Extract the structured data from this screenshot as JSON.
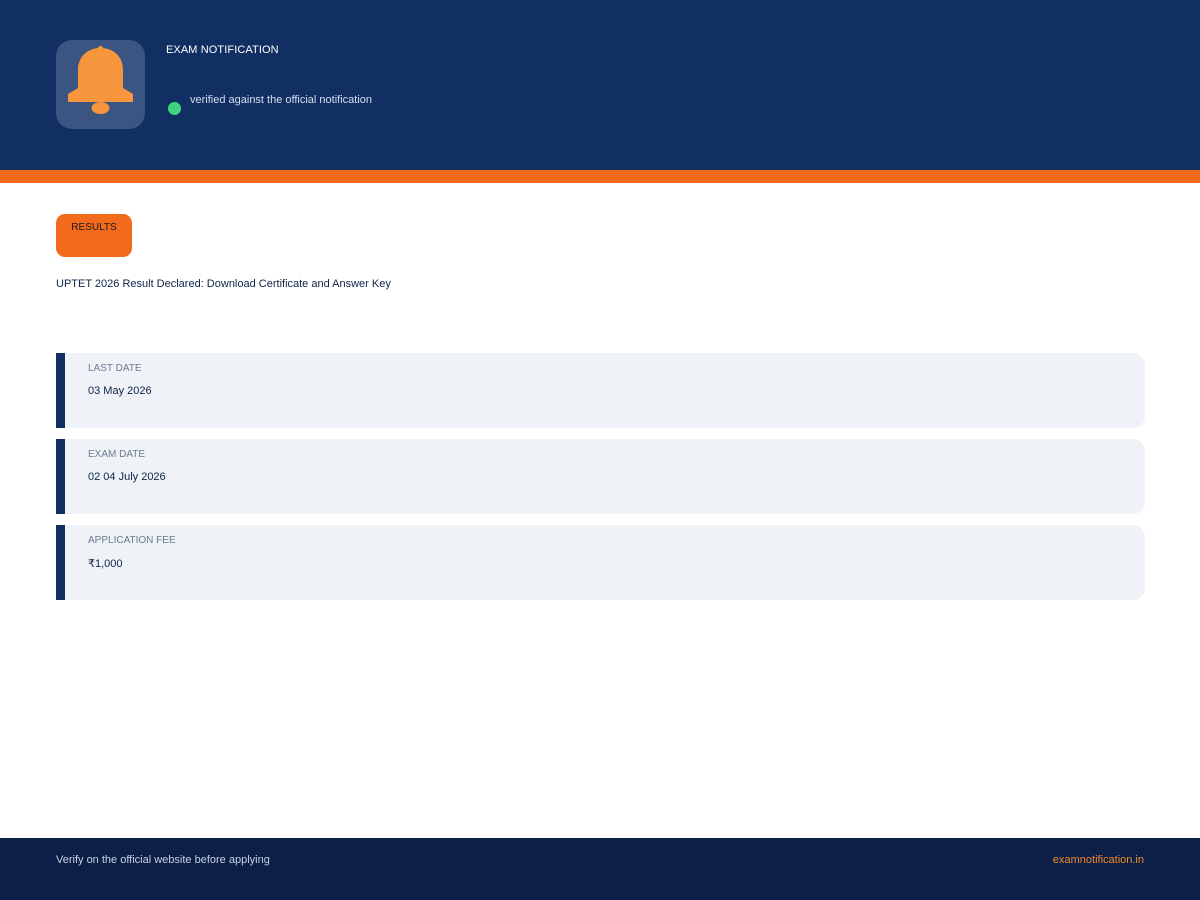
{
  "header": {
    "title": "EXAM NOTIFICATION",
    "verified_text": "verified against the official notification",
    "icon": "bell-icon",
    "verified_status_color": "#3fd37f"
  },
  "category": {
    "label": "RESULTS"
  },
  "headline": "UPTET 2026 Result Declared: Download Certificate and Answer Key",
  "details": [
    {
      "label": "LAST DATE",
      "value": "03 May 2026"
    },
    {
      "label": "EXAM DATE",
      "value": "02 04 July 2026"
    },
    {
      "label": "APPLICATION FEE",
      "value": "₹1,000"
    }
  ],
  "footer": {
    "note": "Verify on the official website before applying",
    "link": "examnotification.in"
  },
  "colors": {
    "header_bg": "#112f62",
    "accent": "#f26b1d",
    "footer_bg": "#0c1f46",
    "card_bg": "#eff3f8",
    "link": "#f28a2e"
  }
}
